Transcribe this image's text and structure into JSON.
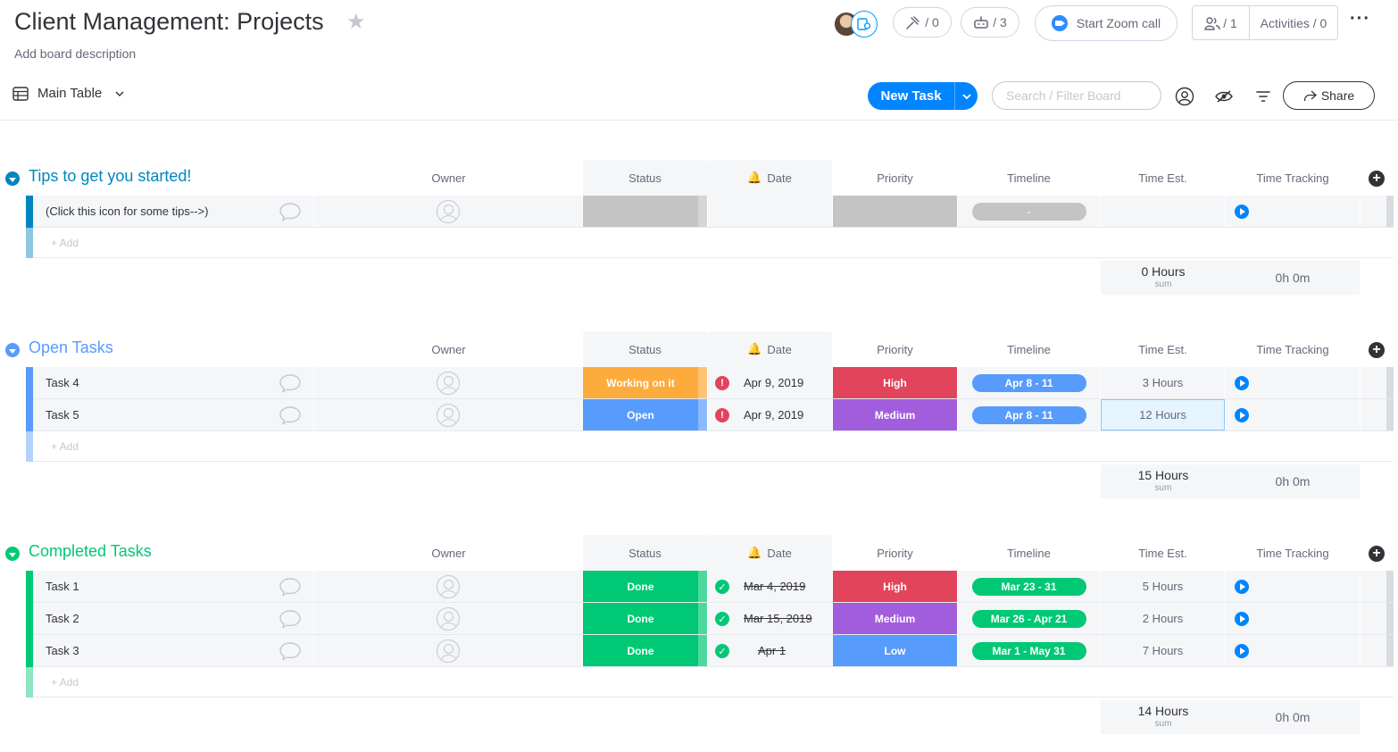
{
  "header": {
    "title": "Client Management: Projects",
    "description": "Add board description",
    "integrations_count": "/ 0",
    "automations_count": "/ 3",
    "zoom_label": "Start Zoom call",
    "members_count": "/ 1",
    "activities_label": "Activities / 0"
  },
  "toolbar": {
    "view_label": "Main Table",
    "new_task_label": "New Task",
    "search_placeholder": "Search / Filter Board",
    "share_label": "Share"
  },
  "columns": {
    "owner": "Owner",
    "status": "Status",
    "date": "Date",
    "priority": "Priority",
    "timeline": "Timeline",
    "time_est": "Time Est.",
    "time_tracking": "Time Tracking"
  },
  "colors": {
    "tips": "#0086c0",
    "open": "#579bfc",
    "completed": "#00c875",
    "working": "#fdab3d",
    "open_status": "#579bfc",
    "done": "#00c875",
    "high": "#e2445c",
    "medium": "#a25ddc",
    "low": "#579bfc",
    "empty": "#c4c4c4"
  },
  "groups": {
    "tips": {
      "title": "Tips to get you started!",
      "add_label": "+ Add",
      "sum_est": "0 Hours",
      "sum_label": "sum",
      "sum_track": "0h 0m",
      "rows": [
        {
          "name": "(Click this icon for some tips-->)",
          "status": "",
          "date": "",
          "priority": "",
          "timeline": "-",
          "est": ""
        }
      ]
    },
    "open": {
      "title": "Open Tasks",
      "add_label": "+ Add",
      "sum_est": "15 Hours",
      "sum_label": "sum",
      "sum_track": "0h 0m",
      "rows": [
        {
          "name": "Task 4",
          "status": "Working on it",
          "date": "Apr 9, 2019",
          "priority": "High",
          "timeline": "Apr 8 - 11",
          "est": "3 Hours"
        },
        {
          "name": "Task 5",
          "status": "Open",
          "date": "Apr 9, 2019",
          "priority": "Medium",
          "timeline": "Apr 8 - 11",
          "est": "12 Hours"
        }
      ]
    },
    "completed": {
      "title": "Completed Tasks",
      "add_label": "+ Add",
      "sum_est": "14 Hours",
      "sum_label": "sum",
      "sum_track": "0h 0m",
      "rows": [
        {
          "name": "Task 1",
          "status": "Done",
          "date": "Mar 4, 2019",
          "priority": "High",
          "timeline": "Mar 23 - 31",
          "est": "5 Hours"
        },
        {
          "name": "Task 2",
          "status": "Done",
          "date": "Mar 15, 2019",
          "priority": "Medium",
          "timeline": "Mar 26 - Apr 21",
          "est": "2 Hours"
        },
        {
          "name": "Task 3",
          "status": "Done",
          "date": "Apr 1",
          "priority": "Low",
          "timeline": "Mar 1 - May 31",
          "est": "7 Hours"
        }
      ]
    }
  }
}
